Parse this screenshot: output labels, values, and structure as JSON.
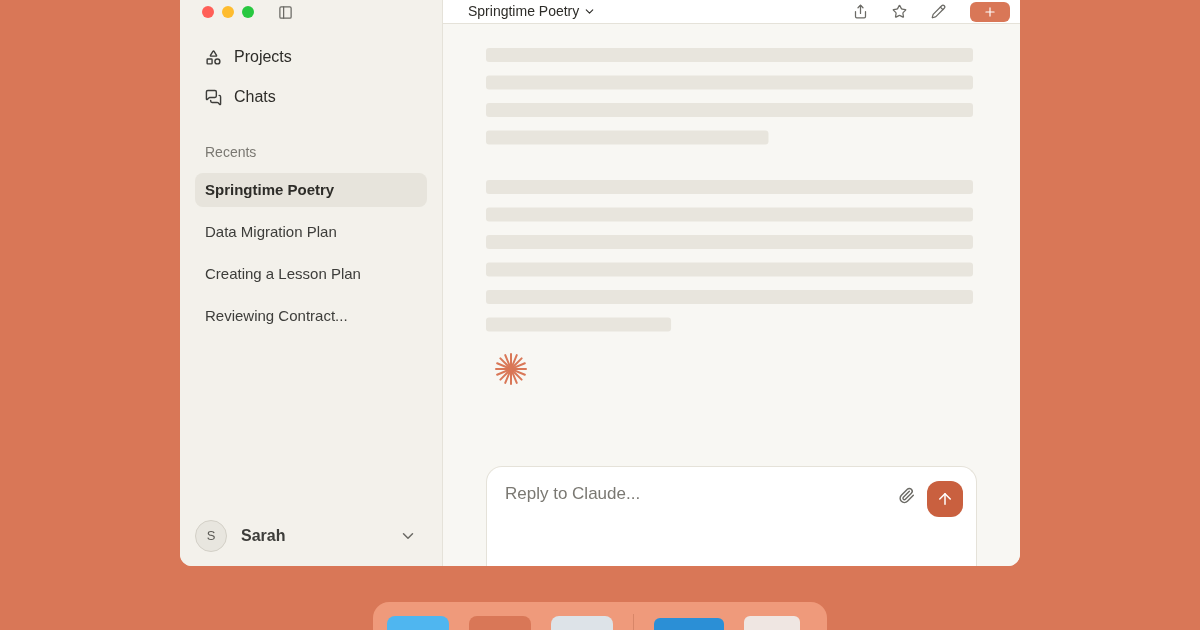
{
  "window": {
    "title": "Springtime Poetry"
  },
  "sidebar": {
    "nav": [
      {
        "kind": "projects",
        "label": "Projects"
      },
      {
        "kind": "chats",
        "label": "Chats"
      }
    ],
    "recents_heading": "Recents",
    "recents": [
      {
        "label": "Springtime Poetry",
        "selected": true
      },
      {
        "label": "Data Migration Plan",
        "selected": false
      },
      {
        "label": "Creating a Lesson Plan",
        "selected": false
      },
      {
        "label": "Reviewing Contract...",
        "selected": false
      }
    ],
    "user": {
      "initial": "S",
      "name": "Sarah"
    }
  },
  "composer": {
    "placeholder": "Reply to Claude..."
  }
}
